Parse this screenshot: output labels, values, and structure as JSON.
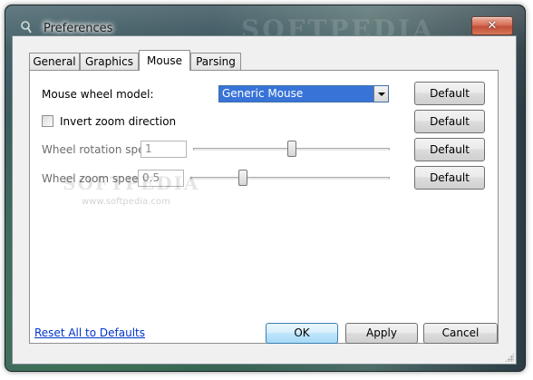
{
  "window": {
    "title": "Preferences",
    "watermark_title": "SOFTPEDIA",
    "close_label": "✕"
  },
  "tabs": [
    {
      "label": "General",
      "active": false
    },
    {
      "label": "Graphics",
      "active": false
    },
    {
      "label": "Mouse",
      "active": true
    },
    {
      "label": "Parsing",
      "active": false
    }
  ],
  "mouse": {
    "wheel_model_label": "Mouse wheel model:",
    "wheel_model_value": "Generic Mouse",
    "invert_zoom_label": "Invert zoom direction",
    "invert_zoom_checked": false,
    "rotation_speed_label": "Wheel rotation speed:",
    "rotation_speed_value": "1",
    "rotation_speed_level": 0.5,
    "zoom_speed_label": "Wheel zoom speed:",
    "zoom_speed_value": "0.5",
    "zoom_speed_level": 0.25,
    "default_label": "Default"
  },
  "watermark": {
    "text": "SOFTPEDIA",
    "sub": "www.softpedia.com"
  },
  "footer": {
    "reset_link": "Reset All to Defaults",
    "ok_label": "OK",
    "apply_label": "Apply",
    "cancel_label": "Cancel"
  },
  "colors": {
    "accent": "#3874d8",
    "link": "#0033cc",
    "close": "#c7452a"
  }
}
